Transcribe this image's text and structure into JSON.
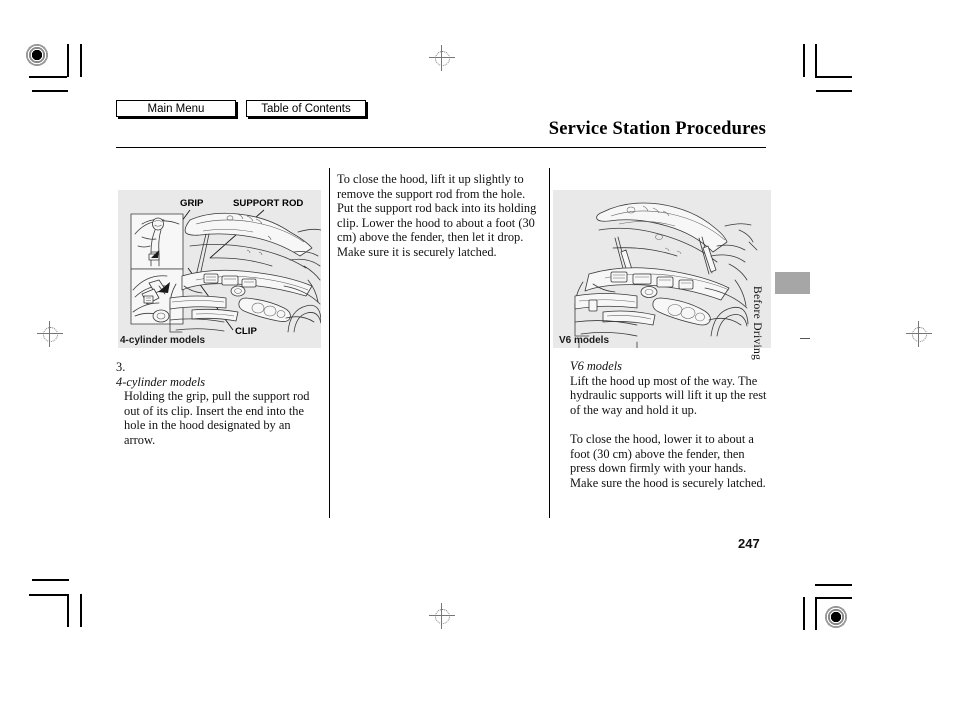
{
  "nav": {
    "main_menu_label": "Main Menu",
    "table_of_contents_label": "Table of Contents"
  },
  "header": {
    "title": "Service Station Procedures"
  },
  "side_tab": {
    "label": "Before Driving"
  },
  "page": {
    "number": "247"
  },
  "figures": {
    "four_cylinder": {
      "caption": "4-cylinder models",
      "callouts": {
        "grip": "GRIP",
        "support_rod": "SUPPORT ROD",
        "clip": "CLIP"
      }
    },
    "v6": {
      "caption": "V6 models"
    }
  },
  "columns": {
    "center": {
      "paragraph_1": "To close the hood, lift it up slightly to remove the support rod from the hole. Put the support rod back into its holding clip. Lower the hood to about a foot (30 cm) above the fender, then let it drop. Make sure it is securely latched."
    },
    "left": {
      "step_number": "3.",
      "step_heading": "4-cylinder models",
      "step_text": "Holding the grip, pull the support rod out of its clip. Insert the end into the hole in the hood designated by an arrow."
    },
    "right": {
      "sub_heading": "V6 models",
      "paragraph_1": "Lift the hood up most of the way. The hydraulic supports will lift it up the rest of the way and hold it up.",
      "paragraph_2": "To close the hood, lower it to about a foot (30 cm) above the fender, then press down firmly with your hands. Make sure the hood is securely latched."
    }
  },
  "colors": {
    "figure_background": "#e9e9e9",
    "side_tab": "#a6a6a6",
    "text": "#111111"
  }
}
